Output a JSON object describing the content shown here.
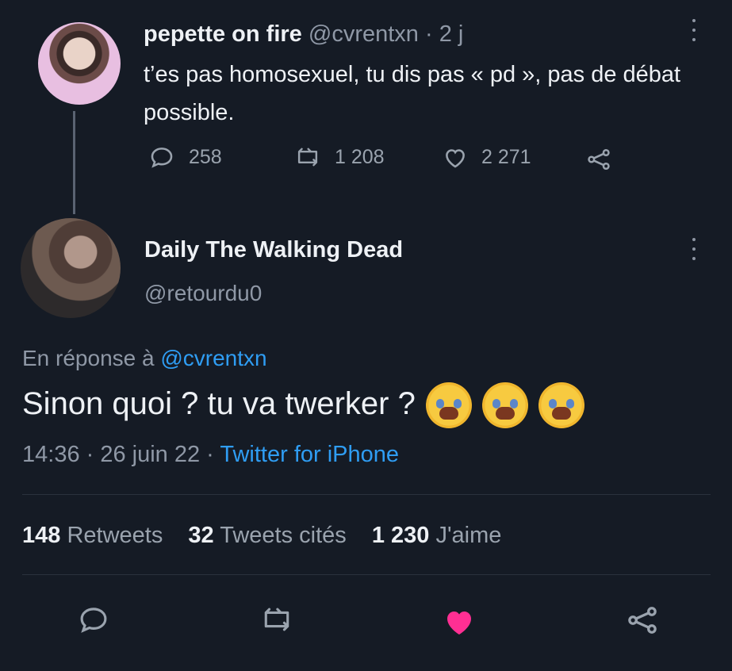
{
  "first_tweet": {
    "display_name": "pepette on fire",
    "handle": "@cvrentxn",
    "time": "2 j",
    "text": "t’es pas homosexuel, tu dis pas « pd », pas de débat possible.",
    "counts": {
      "replies": "258",
      "retweets": "1 208",
      "likes": "2 271"
    }
  },
  "second_tweet": {
    "display_name": "Daily The Walking Dead",
    "handle": "@retourdu0",
    "reply_prefix": "En réponse à",
    "reply_handle": "@cvrentxn",
    "text": "Sinon quoi ? tu va twerker ?",
    "timestamp": "14:36 · 26 juin 22 ·",
    "source": "Twitter for iPhone"
  },
  "stats": {
    "retweets_count": "148",
    "retweets_label": "Retweets",
    "quotes_count": "32",
    "quotes_label": "Tweets cités",
    "likes_count": "1 230",
    "likes_label": "J'aime"
  },
  "icons": {
    "reply": "reply-icon",
    "retweet": "retweet-icon",
    "like": "heart-icon",
    "share": "share-icon",
    "menu": "more-icon",
    "emoji": "loudly-crying-face"
  },
  "colors": {
    "background": "#151b25",
    "accent": "#2f9df3",
    "heart_active": "#ff2f93"
  }
}
